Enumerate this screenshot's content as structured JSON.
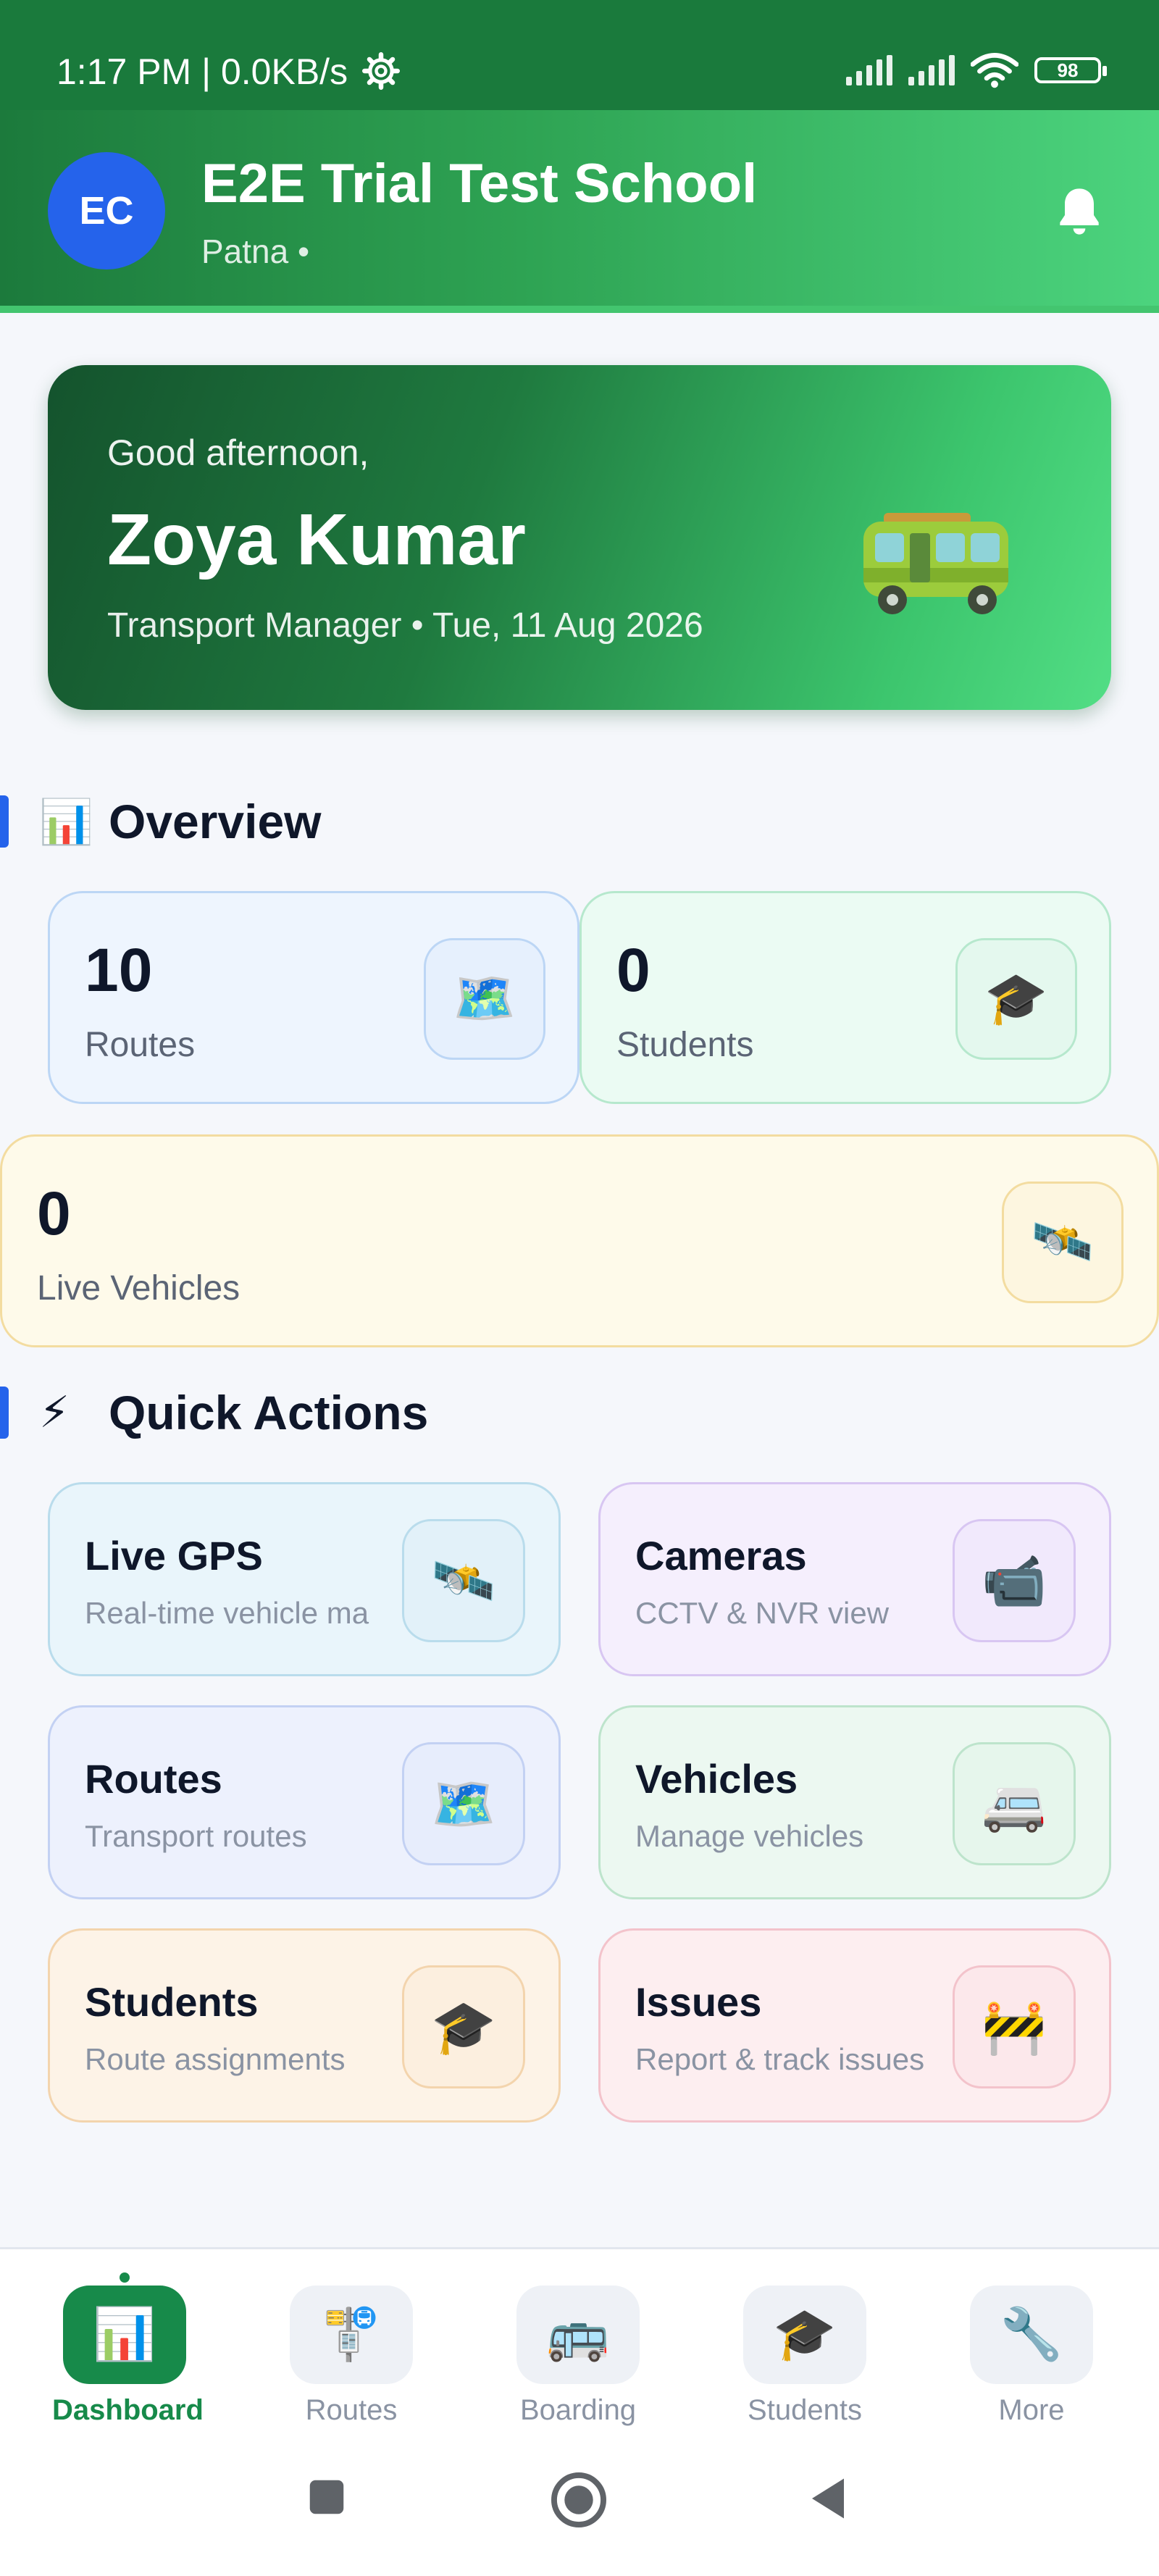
{
  "status_bar": {
    "time": "1:17 PM | 0.0KB/s",
    "battery": "98"
  },
  "header": {
    "avatar_initials": "EC",
    "school_name": "E2E Trial Test School",
    "city": "Patna •"
  },
  "greeting": {
    "hello": "Good afternoon,",
    "name": "Zoya Kumar",
    "subtitle": "Transport Manager  •  Tue, 11 Aug 2026"
  },
  "overview": {
    "title": "Overview",
    "icon": "📊",
    "stats": [
      {
        "value": "10",
        "label": "Routes",
        "icon": "🗺️"
      },
      {
        "value": "0",
        "label": "Students",
        "icon": "🎓"
      },
      {
        "value": "0",
        "label": "Live Vehicles",
        "icon": "🛰️"
      }
    ]
  },
  "quick_actions": {
    "title": "Quick Actions",
    "icon": "⚡",
    "items": [
      {
        "title": "Live GPS",
        "subtitle": "Real-time vehicle ma",
        "icon": "🛰️"
      },
      {
        "title": "Cameras",
        "subtitle": "CCTV & NVR view",
        "icon": "📹"
      },
      {
        "title": "Routes",
        "subtitle": "Transport routes",
        "icon": "🗺️"
      },
      {
        "title": "Vehicles",
        "subtitle": "Manage vehicles",
        "icon": "🚐"
      },
      {
        "title": "Students",
        "subtitle": "Route assignments",
        "icon": "🎓"
      },
      {
        "title": "Issues",
        "subtitle": "Report & track issues",
        "icon": "🚧"
      }
    ]
  },
  "bottom_nav": [
    {
      "label": "Dashboard",
      "icon": "📊"
    },
    {
      "label": "Routes",
      "icon": "🚏"
    },
    {
      "label": "Boarding",
      "icon": "🚌"
    },
    {
      "label": "Students",
      "icon": "🎓"
    },
    {
      "label": "More",
      "icon": "🔧"
    }
  ],
  "colors": {
    "brand_green": "#178a4a",
    "accent_blue": "#2563eb"
  }
}
